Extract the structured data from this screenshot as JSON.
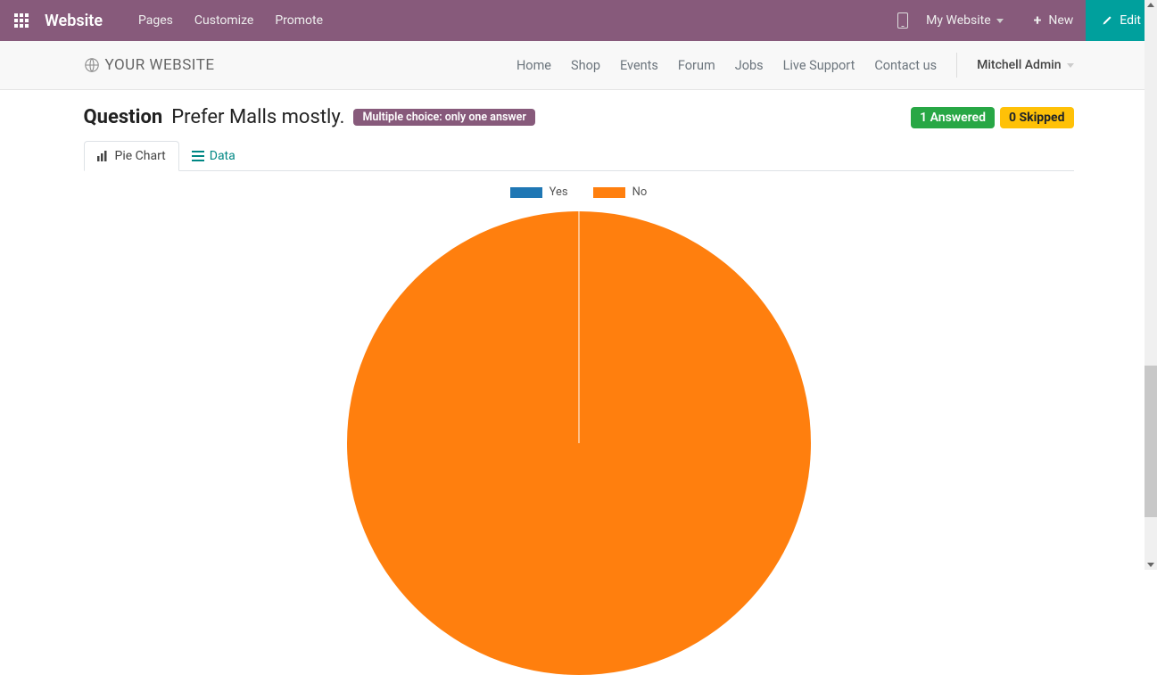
{
  "topbar": {
    "brand": "Website",
    "nav": {
      "pages": "Pages",
      "customize": "Customize",
      "promote": "Promote"
    },
    "my_website": "My Website",
    "new": "New",
    "edit": "Edit"
  },
  "siteheader": {
    "logo_text": "YOUR WEBSITE",
    "nav": {
      "home": "Home",
      "shop": "Shop",
      "events": "Events",
      "forum": "Forum",
      "jobs": "Jobs",
      "live_support": "Live Support",
      "contact": "Contact us"
    },
    "user": "Mitchell Admin"
  },
  "question": {
    "label": "Question",
    "text": "Prefer Malls mostly.",
    "type_badge": "Multiple choice: only one answer",
    "answered": "1 Answered",
    "skipped": "0 Skipped"
  },
  "tabs": {
    "pie": "Pie Chart",
    "data": "Data"
  },
  "legend": {
    "yes": "Yes",
    "no": "No"
  },
  "colors": {
    "yes": "#1f77b4",
    "no": "#ff7f0e",
    "brand": "#875A7B",
    "edit": "#00A09D"
  },
  "chart_data": {
    "type": "pie",
    "title": "",
    "series": [
      {
        "name": "Yes",
        "value": 0,
        "color": "#1f77b4"
      },
      {
        "name": "No",
        "value": 1,
        "color": "#ff7f0e"
      }
    ]
  }
}
